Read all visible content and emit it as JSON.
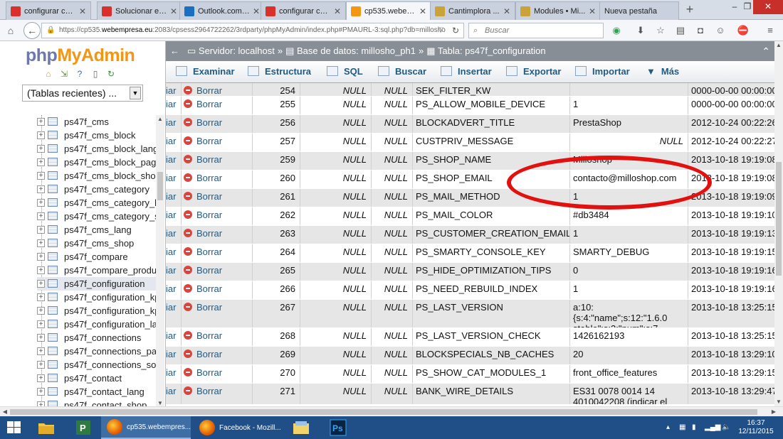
{
  "browser": {
    "tabs": [
      {
        "title": "configurar cor...",
        "favicon": "webempresa-icon",
        "color": "#d9302c",
        "active": false
      },
      {
        "title": "Solucionar el ...",
        "favicon": "webempresa-icon",
        "color": "#d9302c",
        "active": false
      },
      {
        "title": "Outlook.com ...",
        "favicon": "outlook-icon",
        "color": "#1b6ec2",
        "active": false
      },
      {
        "title": "configurar cor...",
        "favicon": "webempresa-icon",
        "color": "#d9302c",
        "active": false
      },
      {
        "title": "cp535.webem...",
        "favicon": "phpmyadmin-icon",
        "color": "#f29613",
        "active": true
      },
      {
        "title": "Cantimplora ...",
        "favicon": "cantimplora-icon",
        "color": "#c9a23a",
        "active": false
      },
      {
        "title": "Modules • Mi...",
        "favicon": "prestashop-icon",
        "color": "#c9a23a",
        "active": false
      },
      {
        "title": "Nueva pestaña",
        "favicon": "",
        "color": "",
        "active": false
      }
    ],
    "url_prefix": "https://cp535.",
    "url_domain": "webempresa.eu",
    "url_rest": ":2083/cpsess2964722262/3rdparty/phpMyAdmin/index.php#PMAURL-3:sql.php?db=millosho",
    "search_placeholder": "Buscar"
  },
  "pma": {
    "logo_php": "php",
    "logo_myadmin": "MyAdmin",
    "recent_tables": "(Tablas recientes) ...",
    "tree": [
      "ps47f_cms",
      "ps47f_cms_block",
      "ps47f_cms_block_lang",
      "ps47f_cms_block_page",
      "ps47f_cms_block_shop",
      "ps47f_cms_category",
      "ps47f_cms_category_lang",
      "ps47f_cms_category_shop",
      "ps47f_cms_lang",
      "ps47f_cms_shop",
      "ps47f_compare",
      "ps47f_compare_product",
      "ps47f_configuration",
      "ps47f_configuration_kpi",
      "ps47f_configuration_kpi_lang",
      "ps47f_configuration_lang",
      "ps47f_connections",
      "ps47f_connections_page",
      "ps47f_connections_source",
      "ps47f_contact",
      "ps47f_contact_lang",
      "ps47f_contact_shop"
    ],
    "selected_table": "ps47f_configuration",
    "breadcrumb": {
      "server": "Servidor: localhost",
      "database": "Base de datos: millosho_ph1",
      "table": "Tabla: ps47f_configuration"
    },
    "tabs": [
      "Examinar",
      "Estructura",
      "SQL",
      "Buscar",
      "Insertar",
      "Exportar",
      "Importar",
      "Más"
    ],
    "edit_label": "iar",
    "delete_label": "Borrar",
    "rows": [
      {
        "id": "254",
        "n1": "NULL",
        "n2": "NULL",
        "name": "SEK_FILTER_KW",
        "value": "",
        "date": "0000-00-00 00:00:00"
      },
      {
        "id": "255",
        "n1": "NULL",
        "n2": "NULL",
        "name": "PS_ALLOW_MOBILE_DEVICE",
        "value": "1",
        "date": "0000-00-00 00:00:00"
      },
      {
        "id": "256",
        "n1": "NULL",
        "n2": "NULL",
        "name": "BLOCKADVERT_TITLE",
        "value": "PrestaShop",
        "date": "2012-10-24 00:22:26"
      },
      {
        "id": "257",
        "n1": "NULL",
        "n2": "NULL",
        "name": "CUSTPRIV_MESSAGE",
        "value": "NULL",
        "date": "2012-10-24 00:22:27"
      },
      {
        "id": "259",
        "n1": "NULL",
        "n2": "NULL",
        "name": "PS_SHOP_NAME",
        "value": "Milloshop",
        "date": "2013-10-18 19:19:08"
      },
      {
        "id": "260",
        "n1": "NULL",
        "n2": "NULL",
        "name": "PS_SHOP_EMAIL",
        "value": "contacto@milloshop.com",
        "date": "2013-10-18 19:19:08"
      },
      {
        "id": "261",
        "n1": "NULL",
        "n2": "NULL",
        "name": "PS_MAIL_METHOD",
        "value": "1",
        "date": "2013-10-18 19:19:09"
      },
      {
        "id": "262",
        "n1": "NULL",
        "n2": "NULL",
        "name": "PS_MAIL_COLOR",
        "value": "#db3484",
        "date": "2013-10-18 19:19:10"
      },
      {
        "id": "263",
        "n1": "NULL",
        "n2": "NULL",
        "name": "PS_CUSTOMER_CREATION_EMAIL",
        "value": "1",
        "date": "2013-10-18 19:19:13"
      },
      {
        "id": "264",
        "n1": "NULL",
        "n2": "NULL",
        "name": "PS_SMARTY_CONSOLE_KEY",
        "value": "SMARTY_DEBUG",
        "date": "2013-10-18 19:19:15"
      },
      {
        "id": "265",
        "n1": "NULL",
        "n2": "NULL",
        "name": "PS_HIDE_OPTIMIZATION_TIPS",
        "value": "0",
        "date": "2013-10-18 19:19:16"
      },
      {
        "id": "266",
        "n1": "NULL",
        "n2": "NULL",
        "name": "PS_NEED_REBUILD_INDEX",
        "value": "1",
        "date": "2013-10-18 19:19:16"
      },
      {
        "id": "267",
        "n1": "NULL",
        "n2": "NULL",
        "name": "PS_LAST_VERSION",
        "value": "a:10:{s:4:\"name\";s:12:\"1.6.0 stable\";s:3:\"num\";s:7...",
        "date": "2013-10-18 13:25:15"
      },
      {
        "id": "268",
        "n1": "NULL",
        "n2": "NULL",
        "name": "PS_LAST_VERSION_CHECK",
        "value": "1426162193",
        "date": "2013-10-18 13:25:15"
      },
      {
        "id": "269",
        "n1": "NULL",
        "n2": "NULL",
        "name": "BLOCKSPECIALS_NB_CACHES",
        "value": "20",
        "date": "2013-10-18 13:29:10"
      },
      {
        "id": "270",
        "n1": "NULL",
        "n2": "NULL",
        "name": "PS_SHOW_CAT_MODULES_1",
        "value": "front_office_features",
        "date": "2013-10-18 13:29:15"
      },
      {
        "id": "271",
        "n1": "NULL",
        "n2": "NULL",
        "name": "BANK_WIRE_DETAILS",
        "value": "ES31 0078 0014 14 4010042208 (indicar el",
        "date": "2013-10-18 13:29:47"
      }
    ],
    "highlight_color": "#e31010"
  },
  "taskbar": {
    "items": [
      "cp535.webempres...",
      "Facebook - Mozill..."
    ],
    "time": "16:37",
    "date": "12/11/2015"
  }
}
